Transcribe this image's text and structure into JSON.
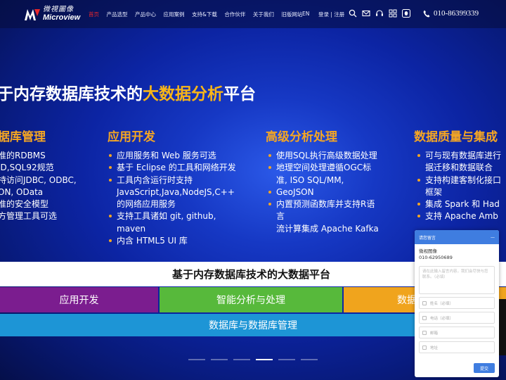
{
  "logo": {
    "cn": "微視圖像",
    "en": "Microview"
  },
  "nav": [
    {
      "label": "首页",
      "active": true
    },
    {
      "label": "产品选型",
      "active": false
    },
    {
      "label": "产品中心",
      "active": false
    },
    {
      "label": "应用案例",
      "active": false
    },
    {
      "label": "支持&下载",
      "active": false
    },
    {
      "label": "合作伙伴",
      "active": false
    },
    {
      "label": "关于我们",
      "active": false
    },
    {
      "label": "旧版网站",
      "active": false
    }
  ],
  "lang": "EN",
  "login": "登录 | 注册",
  "header_icons": [
    "search-icon",
    "mail-icon",
    "headset-icon",
    "grid-icon",
    "qq-icon"
  ],
  "phone": "010-86399339",
  "hero": {
    "title_pre": "于内存数据库技术的",
    "title_hl": "大数据分析",
    "title_post": "平台",
    "columns": [
      {
        "title": "据库管理",
        "items": [
          "准的RDBMS",
          "ID,SQL92规范",
          "持访问JDBC, ODBC,",
          "ON, OData",
          "准的安全模型",
          "方管理工具可选"
        ]
      },
      {
        "title": "应用开发",
        "items": [
          "应用服务和 Web 服务可选",
          "基于 Eclipse 的工具和网络开发",
          "工具内含运行时支持",
          "JavaScript,Java,NodeJS,C++",
          "的网络应用服务",
          "支持工具诸如 git, github,",
          "maven",
          "内含 HTML5 UI 库"
        ]
      },
      {
        "title": "高级分析处理",
        "items": [
          "使用SQL执行高级数据处理",
          "地理空间处理遵循OGC标",
          "准, ISO SQL/MM,",
          "GeoJSON",
          "内置预测函数库并支持R语",
          "言",
          "流计算集成 Apache Kafka"
        ]
      },
      {
        "title": "数据质量与集成",
        "items": [
          "可与现有数据库进行",
          "据迁移和数据联合",
          "支持构建客制化接口",
          "框架",
          "集成 Spark 和 Had",
          "支持 Apache Amb"
        ]
      }
    ]
  },
  "arch": {
    "head": "基于内存数据库技术的大数据平台",
    "row": [
      "应用开发",
      "智能分析与处理",
      "数据"
    ],
    "bottom": "数据库与数据库管理"
  },
  "colors": {
    "accent": "#f5a623",
    "purple": "#7b1d8f",
    "green": "#57b93b",
    "orange": "#f0a41d",
    "blue": "#1d95d6",
    "nav_active": "#e8262b"
  },
  "chat": {
    "head": "请您留言",
    "company": "微视图像",
    "tel": "010-62950689",
    "msg_placeholder": "请在此输入留言内容，我们会尽快与您联系。（必填）",
    "fields": [
      {
        "placeholder": "姓名（必填）"
      },
      {
        "placeholder": "电话（必填）"
      },
      {
        "placeholder": "邮箱"
      },
      {
        "placeholder": "地址"
      }
    ],
    "submit": "提交"
  }
}
